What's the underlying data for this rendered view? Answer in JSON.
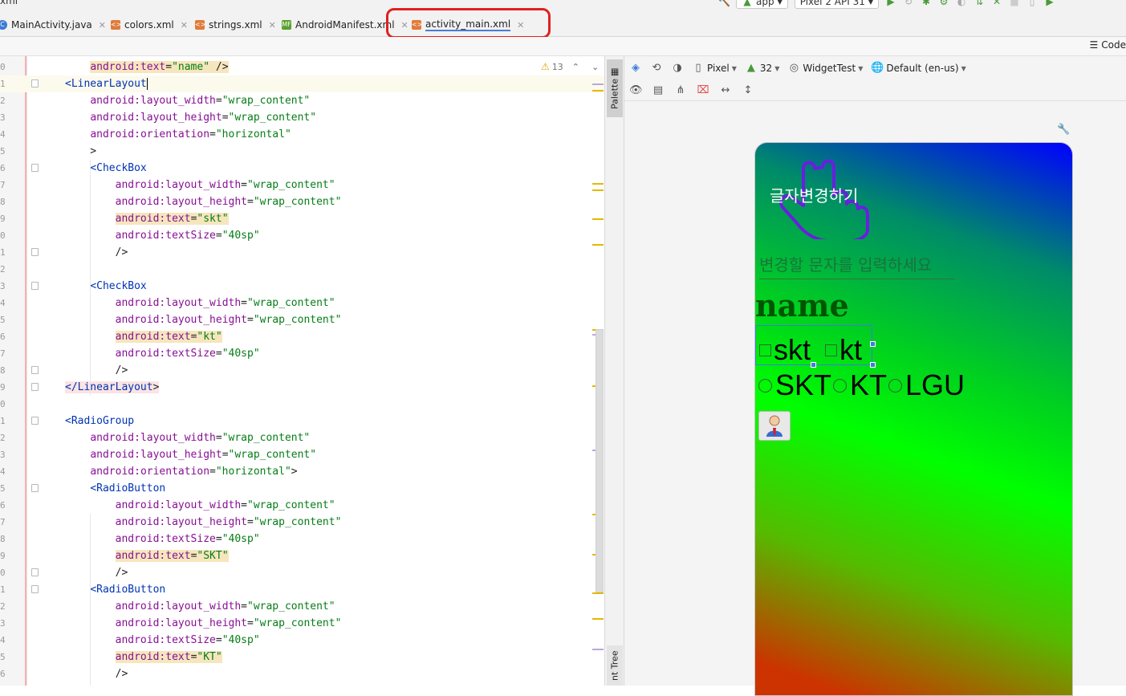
{
  "topbar": {
    "project": "xml",
    "run_config": "app",
    "device": "Pixel 2 API 31"
  },
  "tabs": [
    {
      "label": "MainActivity.java",
      "icon": "java-class-icon",
      "color": "#3a7bd5"
    },
    {
      "label": "colors.xml",
      "icon": "xml-file-icon",
      "color": "#e07b39"
    },
    {
      "label": "strings.xml",
      "icon": "xml-file-icon",
      "color": "#e07b39"
    },
    {
      "label": "AndroidManifest.xml",
      "icon": "manifest-file-icon",
      "color": "#5aa02c"
    },
    {
      "label": "activity_main.xml",
      "icon": "xml-file-icon",
      "color": "#e07b39",
      "active": true
    }
  ],
  "subbar": {
    "mode": "Code"
  },
  "editor": {
    "warnings": "13",
    "line_numbers": [
      "0",
      "1",
      "2",
      "3",
      "4",
      "5",
      "6",
      "7",
      "8",
      "9",
      "0",
      "1",
      "2",
      "3",
      "4",
      "5",
      "6",
      "7",
      "8",
      "9",
      "0",
      "1",
      "2",
      "3",
      "4",
      "5",
      "6",
      "7",
      "8",
      "9",
      "0",
      "1",
      "2",
      "3",
      "4",
      "5",
      "6",
      "7"
    ],
    "lines": [
      {
        "text": "    android:text=\"name\" />"
      },
      {
        "text": "<LinearLayout"
      },
      {
        "text": "    android:layout_width=\"wrap_content\""
      },
      {
        "text": "    android:layout_height=\"wrap_content\""
      },
      {
        "text": "    android:orientation=\"horizontal\""
      },
      {
        "text": "    >"
      },
      {
        "text": "    <CheckBox"
      },
      {
        "text": "        android:layout_width=\"wrap_content\""
      },
      {
        "text": "        android:layout_height=\"wrap_content\""
      },
      {
        "text": "        android:text=\"skt\""
      },
      {
        "text": "        android:textSize=\"40sp\""
      },
      {
        "text": "        />"
      },
      {
        "text": ""
      },
      {
        "text": "    <CheckBox"
      },
      {
        "text": "        android:layout_width=\"wrap_content\""
      },
      {
        "text": "        android:layout_height=\"wrap_content\""
      },
      {
        "text": "        android:text=\"kt\""
      },
      {
        "text": "        android:textSize=\"40sp\""
      },
      {
        "text": "        />"
      },
      {
        "text": "</LinearLayout>"
      },
      {
        "text": ""
      },
      {
        "text": "<RadioGroup"
      },
      {
        "text": "    android:layout_width=\"wrap_content\""
      },
      {
        "text": "    android:layout_height=\"wrap_content\""
      },
      {
        "text": "    android:orientation=\"horizontal\">"
      },
      {
        "text": "    <RadioButton"
      },
      {
        "text": "        android:layout_width=\"wrap_content\""
      },
      {
        "text": "        android:layout_height=\"wrap_content\""
      },
      {
        "text": "        android:textSize=\"40sp\""
      },
      {
        "text": "        android:text=\"SKT\""
      },
      {
        "text": "        />"
      },
      {
        "text": "    <RadioButton"
      },
      {
        "text": "        android:layout_width=\"wrap_content\""
      },
      {
        "text": "        android:layout_height=\"wrap_content\""
      },
      {
        "text": "        android:textSize=\"40sp\""
      },
      {
        "text": "        android:text=\"KT\""
      },
      {
        "text": "        />"
      }
    ]
  },
  "side_tabs": {
    "palette": "Palette",
    "component_tree": "nt Tree"
  },
  "design_toolbar": {
    "device": "Pixel",
    "api": "32",
    "theme": "WidgetTest",
    "locale": "Default (en-us)"
  },
  "preview": {
    "button_text": "글자변경하기",
    "edit_hint": "변경할 문자를 입력하세요",
    "name_text": "name",
    "checkboxes": [
      "skt",
      "kt"
    ],
    "radios": [
      "SKT",
      "KT",
      "LGU"
    ]
  }
}
